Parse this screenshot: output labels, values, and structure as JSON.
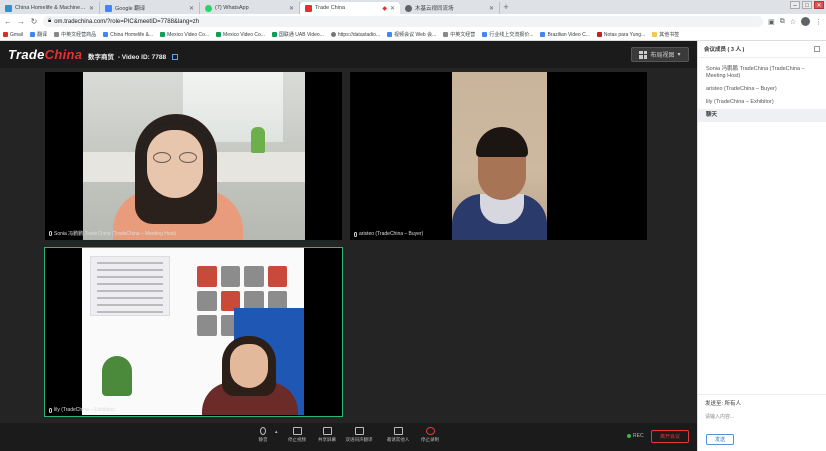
{
  "browser": {
    "tabs": [
      {
        "title": "China Homelife & Machinex 2...",
        "color": "#2f8fcf",
        "active": false
      },
      {
        "title": "Google 翻译",
        "color": "#4285f4",
        "active": false
      },
      {
        "title": "(7) WhatsApp",
        "color": "#25d366",
        "active": false
      },
      {
        "title": "Trade China",
        "color": "#e33131",
        "active": true
      },
      {
        "title": "木基云视同流场",
        "color": "#5f6368",
        "active": false
      }
    ],
    "url": "om.tradechina.com/?role=PIC&meetID=7788&lang=zh",
    "bookmarks": [
      "Gmail",
      "翻译",
      "中英文经营商品",
      "China Homelife &...",
      "Mexico Video Co...",
      "Mexico Video Co...",
      "国联通 UAB Video...",
      "https://datastadio...",
      "视频会议 Web 会...",
      "中英文经营",
      "行业线上交流报价...",
      "Brazilian Video C...",
      "Notas para Yung...",
      "其他书签"
    ]
  },
  "app": {
    "logo_trade": "Trade",
    "logo_china": "China",
    "meeting_name": "数字商贸",
    "video_id_label": "- Video ID: 7788",
    "layout_button": "布局视图"
  },
  "videos": [
    {
      "label": "Sonia 冯鹏鹏 TradeChina (TradeChina – Meeting Host)"
    },
    {
      "label": "aristeo (TradeChina – Buyer)"
    },
    {
      "label": "lily (TradeChina – Exhibitor)"
    }
  ],
  "toolbar": {
    "items": [
      "静音",
      "停止视频",
      "共享屏幕",
      "双语同声翻译",
      "邀请其他人",
      "停止录制"
    ],
    "rec_label": "REC",
    "leave_label": "离开会议"
  },
  "sidebar": {
    "title": "会议成员 ( 3 人 )",
    "members": [
      "Sonia 冯鹏鹏 TradeChina (TradeChina – Meeting Host)",
      "aristeo (TradeChina – Buyer)",
      "lily (TradeChina – Exhibitor)"
    ],
    "selected": "聊天",
    "recipient": "发送至: 所有人",
    "input_placeholder": "请输入内容...",
    "send_label": "发送"
  }
}
